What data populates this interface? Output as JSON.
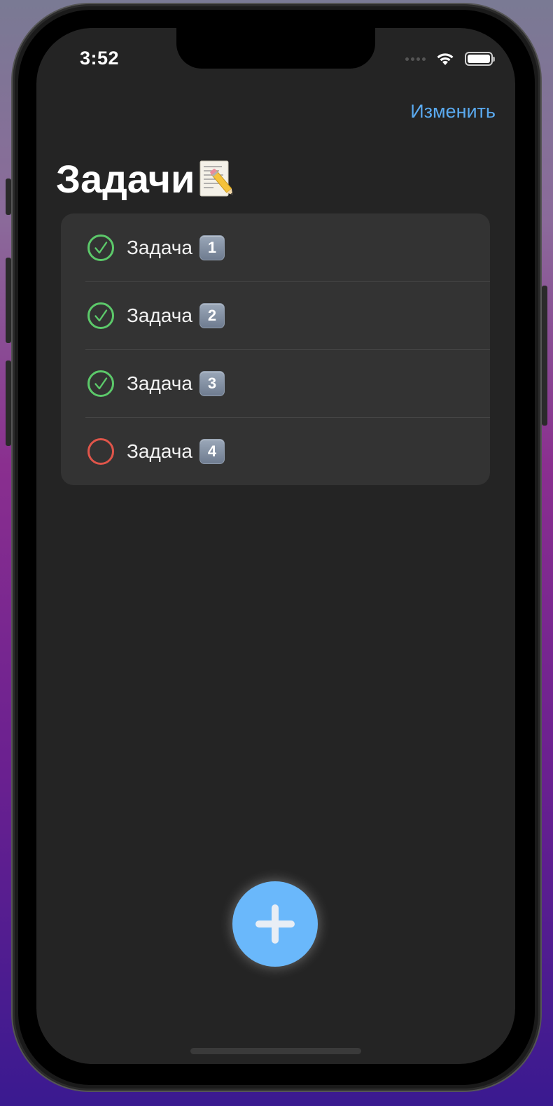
{
  "status_bar": {
    "time": "3:52",
    "wifi_icon": "wifi-icon",
    "battery_icon": "battery-icon"
  },
  "nav": {
    "edit_label": "Изменить"
  },
  "title": {
    "text": "Задачи",
    "icon": "memo-icon"
  },
  "tasks": [
    {
      "label": "Задача",
      "badge": "1",
      "done": true
    },
    {
      "label": "Задача",
      "badge": "2",
      "done": true
    },
    {
      "label": "Задача",
      "badge": "3",
      "done": true
    },
    {
      "label": "Задача",
      "badge": "4",
      "done": false
    }
  ],
  "colors": {
    "accent": "#5aaaf0",
    "done": "#5cc96a",
    "not_done": "#e0554a",
    "fab": "#6ab8fb",
    "background": "#242424",
    "list_background": "#333333"
  },
  "fab": {
    "icon": "plus-icon"
  }
}
